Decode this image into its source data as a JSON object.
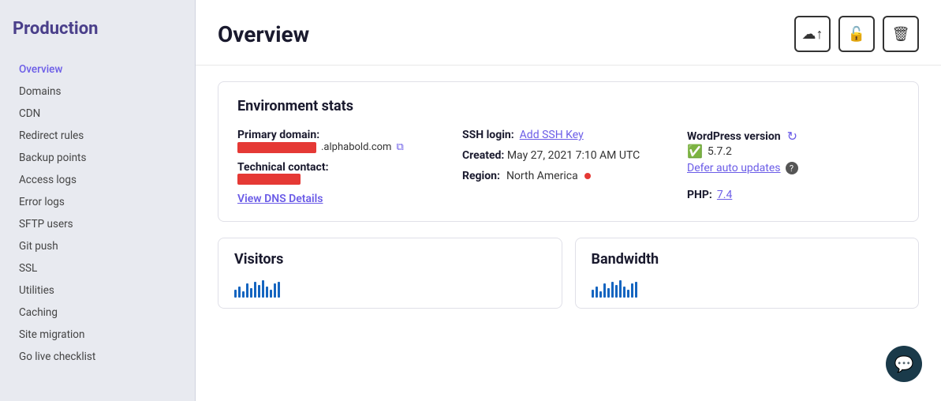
{
  "sidebar": {
    "title": "Production",
    "nav_items": [
      {
        "id": "overview",
        "label": "Overview",
        "active": true
      },
      {
        "id": "domains",
        "label": "Domains",
        "active": false
      },
      {
        "id": "cdn",
        "label": "CDN",
        "active": false
      },
      {
        "id": "redirect-rules",
        "label": "Redirect rules",
        "active": false
      },
      {
        "id": "backup-points",
        "label": "Backup points",
        "active": false
      },
      {
        "id": "access-logs",
        "label": "Access logs",
        "active": false
      },
      {
        "id": "error-logs",
        "label": "Error logs",
        "active": false
      },
      {
        "id": "sftp-users",
        "label": "SFTP users",
        "active": false
      },
      {
        "id": "git-push",
        "label": "Git push",
        "active": false
      },
      {
        "id": "ssl",
        "label": "SSL",
        "active": false
      },
      {
        "id": "utilities",
        "label": "Utilities",
        "active": false
      },
      {
        "id": "caching",
        "label": "Caching",
        "active": false
      },
      {
        "id": "site-migration",
        "label": "Site migration",
        "active": false
      },
      {
        "id": "go-live-checklist",
        "label": "Go live checklist",
        "active": false
      }
    ]
  },
  "header": {
    "title": "Overview",
    "buttons": {
      "upload_label": "⬆",
      "lock_label": "🔒",
      "delete_label": "🗑"
    }
  },
  "stats_card": {
    "title": "Environment stats",
    "primary_domain_label": "Primary domain:",
    "domain_suffix": ".alphabold.com",
    "technical_contact_label": "Technical contact:",
    "view_dns_label": "View DNS Details",
    "ssh_login_label": "SSH login:",
    "add_ssh_label": "Add SSH Key",
    "created_label": "Created:",
    "created_value": "May 27, 2021 7:10 AM UTC",
    "region_label": "Region:",
    "region_value": "North America",
    "wp_version_label": "WordPress version",
    "wp_version_value": "5.7.2",
    "defer_auto_label": "Defer auto updates",
    "php_label": "PHP:",
    "php_value": "7.4"
  },
  "bottom_cards": [
    {
      "title": "Visitors"
    },
    {
      "title": "Bandwidth"
    }
  ],
  "chat": {
    "icon": "💬"
  }
}
